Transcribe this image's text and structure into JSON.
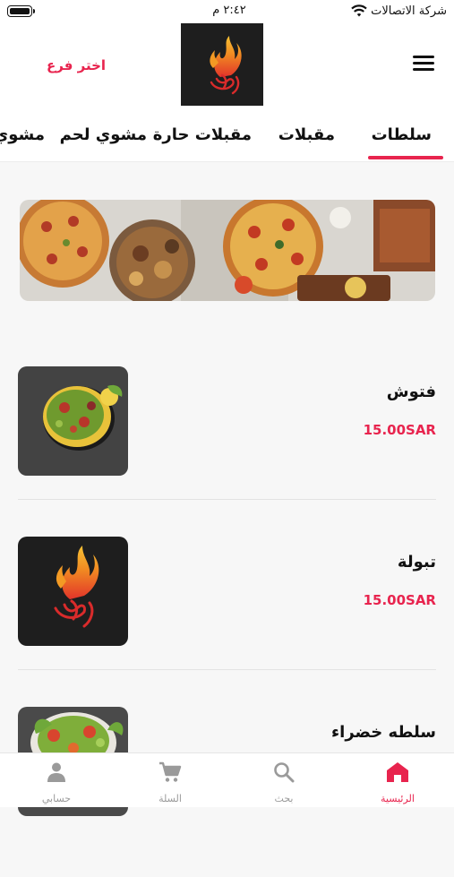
{
  "status_bar": {
    "carrier": "شركة الاتصالات",
    "time": "٢:٤٢ م"
  },
  "header": {
    "branch_label": "اختر فرع",
    "logo_icon": "restaurant-flame-logo",
    "menu_icon": "hamburger-menu-icon"
  },
  "tabs": [
    {
      "label": "سلطات",
      "active": true
    },
    {
      "label": "مقبلات",
      "active": false
    },
    {
      "label": "مقبلات حارة",
      "active": false
    },
    {
      "label": "مشوي لحم",
      "active": false
    },
    {
      "label": "مشوي",
      "active": false
    }
  ],
  "products": [
    {
      "name": "فتوش",
      "price": "15.00SAR",
      "image": "fattoush-salad"
    },
    {
      "name": "تبولة",
      "price": "15.00SAR",
      "image": "restaurant-logo"
    },
    {
      "name": "سلطه خضراء",
      "price": "",
      "image": "green-salad"
    }
  ],
  "bottom_nav": [
    {
      "label": "الرئيسية",
      "icon": "home-icon",
      "active": true
    },
    {
      "label": "بحث",
      "icon": "search-icon",
      "active": false
    },
    {
      "label": "السلة",
      "icon": "cart-icon",
      "active": false
    },
    {
      "label": "حسابي",
      "icon": "person-icon",
      "active": false
    }
  ],
  "colors": {
    "accent": "#e8244e",
    "logo_bg": "#1e1e1e",
    "inactive": "#9a9a9a"
  }
}
